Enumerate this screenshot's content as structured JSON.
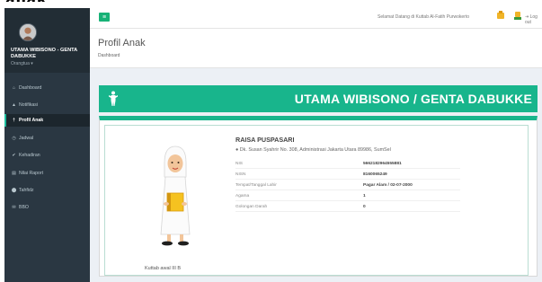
{
  "top_fragment": "anak",
  "sidebar": {
    "user_name": "UTAMA WIBISONO - GENTA DABUKKE",
    "user_role": "Orangtua",
    "items": [
      {
        "icon": "⌂",
        "icon_name": "dashboard-icon",
        "label": "Dashboard"
      },
      {
        "icon": "▲",
        "icon_name": "bell-icon",
        "label": "Notifikasi"
      },
      {
        "icon": "†",
        "icon_name": "child-icon",
        "label": "Profil Anak",
        "active": true
      },
      {
        "icon": "◷",
        "icon_name": "clock-icon",
        "label": "Jadwal"
      },
      {
        "icon": "✔",
        "icon_name": "check-icon",
        "label": "Kehadiran"
      },
      {
        "icon": "▤",
        "icon_name": "chart-icon",
        "label": "Nilai Raport"
      },
      {
        "icon": "⬤",
        "icon_name": "quran-icon",
        "label": "Tahfidz"
      },
      {
        "icon": "✉",
        "icon_name": "tag-icon",
        "label": "BBO"
      }
    ]
  },
  "topbar": {
    "menu_icon": "≡",
    "welcome": "Selamat Datang di Kuttab Al-Fatih Purwokerto",
    "logout": "Log out",
    "logout_icon": "⇥"
  },
  "page": {
    "title": "Profil Anak",
    "breadcrumb": "Dashboard"
  },
  "banner": {
    "title": "UTAMA WIBISONO / GENTA DABUKKE"
  },
  "profile": {
    "name": "RAISA PUSPASARI",
    "address": "Dk. Susan Syahrir No. 308, Administrasi Jakarta Utara 89986, SumSel",
    "pin_icon": "●",
    "caption": "Kuttab awal III B",
    "fields": [
      {
        "label": "NIS",
        "value": "5662182964555881"
      },
      {
        "label": "NISN",
        "value": "8160065249"
      },
      {
        "label": "Tempat/Tanggal Lahir",
        "value": "Pagar Alam / 02-07-2000"
      },
      {
        "label": "Agama",
        "value": "1"
      },
      {
        "label": "Golongan Darah",
        "value": "0"
      }
    ]
  },
  "colors": {
    "accent": "#18b58c",
    "sidebar": "#2a3742"
  }
}
